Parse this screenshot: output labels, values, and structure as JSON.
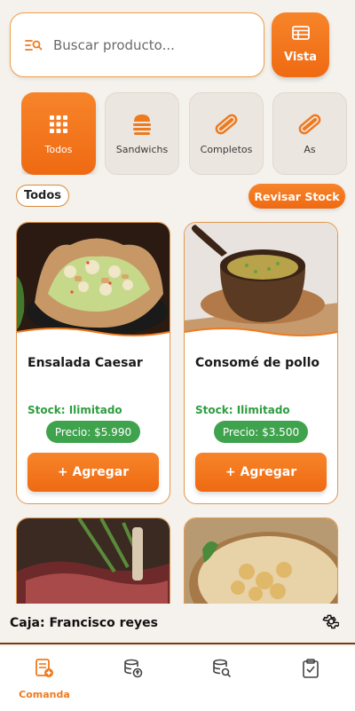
{
  "search": {
    "placeholder": "Buscar producto..."
  },
  "view_button": {
    "label": "Vista"
  },
  "categories": [
    {
      "label": "Todos",
      "icon": "grid-icon",
      "active": true
    },
    {
      "label": "Sandwichs",
      "icon": "burger-icon",
      "active": false
    },
    {
      "label": "Completos",
      "icon": "hotdog-icon",
      "active": false
    },
    {
      "label": "As",
      "icon": "hotdog-icon",
      "active": false
    }
  ],
  "filter": {
    "label": "Todos"
  },
  "stock_button": {
    "label": "Revisar Stock"
  },
  "products": [
    {
      "name": "Ensalada Caesar",
      "stock": "Stock: Ilimitado",
      "price": "Precio: $5.990",
      "add": "+ Agregar"
    },
    {
      "name": "Consomé de pollo",
      "stock": "Stock: Ilimitado",
      "price": "Precio: $3.500",
      "add": "+ Agregar"
    }
  ],
  "cashier": {
    "label": "Caja: Francisco reyes"
  },
  "tabs": [
    {
      "label": "Comanda",
      "icon": "order-icon",
      "active": true
    },
    {
      "label": "",
      "icon": "database-upload-icon",
      "active": false
    },
    {
      "label": "",
      "icon": "database-search-icon",
      "active": false
    },
    {
      "label": "",
      "icon": "clipboard-check-icon",
      "active": false
    }
  ],
  "colors": {
    "accent": "#ef7a1e",
    "stock_green": "#2e9d3f",
    "price_green": "#3fa34d",
    "background": "#f5f1ec"
  }
}
